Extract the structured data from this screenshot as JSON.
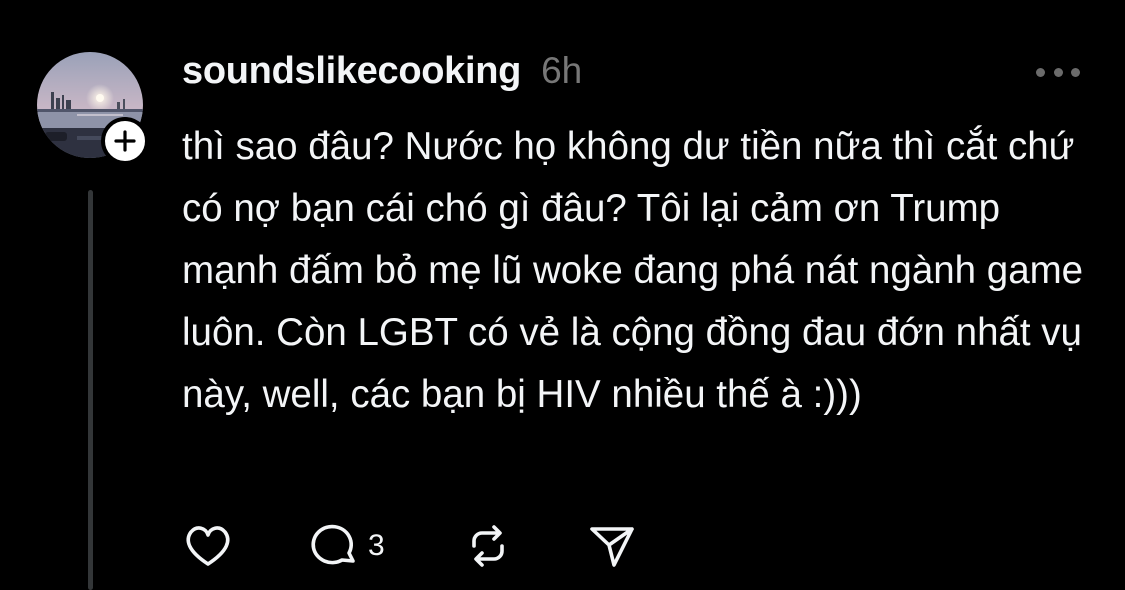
{
  "post": {
    "username": "soundslikecooking",
    "time": "6h",
    "text": "thì sao đâu? Nước họ không dư tiền nữa thì cắt chứ có nợ bạn cái chó gì đâu? Tôi lại cảm ơn Trump mạnh đấm bỏ mẹ lũ woke đang phá nát ngành game luôn. Còn LGBT có vẻ là cộng đồng đau đớn nhất vụ này, well, các bạn bị HIV nhiều thế à :)))",
    "reply_count": "3"
  },
  "icons": {
    "follow": "plus-icon",
    "more": "more-horizontal-icon",
    "like": "heart-icon",
    "reply": "comment-icon",
    "repost": "repost-icon",
    "share": "send-icon"
  },
  "colors": {
    "background": "#000000",
    "text": "#f3f5f7",
    "muted": "#777777",
    "thread_line": "#333638"
  }
}
